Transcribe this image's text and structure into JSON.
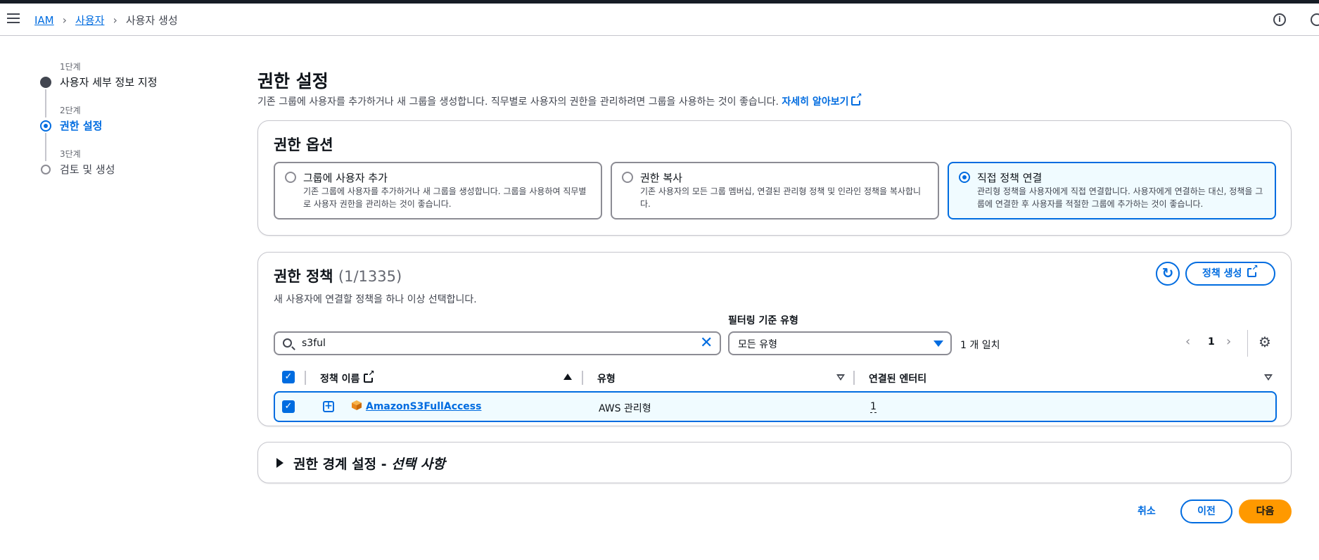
{
  "breadcrumb": {
    "items": [
      "IAM",
      "사용자"
    ],
    "current": "사용자 생성"
  },
  "icons": [
    "hamburger-icon",
    "info-icon",
    "search-icon",
    "clear-icon",
    "refresh-icon",
    "external-link-icon",
    "gear-icon",
    "aws-policy-icon",
    "expand-icon"
  ],
  "steps": [
    {
      "label": "1단계",
      "title": "사용자 세부 정보 지정",
      "state": "done"
    },
    {
      "label": "2단계",
      "title": "권한 설정",
      "state": "active"
    },
    {
      "label": "3단계",
      "title": "검토 및 생성",
      "state": "pending"
    }
  ],
  "page": {
    "title": "권한 설정",
    "description": "기존 그룹에 사용자를 추가하거나 새 그룹을 생성합니다. 직무별로 사용자의 권한을 관리하려면 그룹을 사용하는 것이 좋습니다.",
    "learn_more": "자세히 알아보기"
  },
  "permission_options": {
    "title": "권한 옵션",
    "options": [
      {
        "title": "그룹에 사용자 추가",
        "desc": "기존 그룹에 사용자를 추가하거나 새 그룹을 생성합니다. 그룹을 사용하여 직무별로 사용자 권한을 관리하는 것이 좋습니다.",
        "selected": false
      },
      {
        "title": "권한 복사",
        "desc": "기존 사용자의 모든 그룹 멤버십, 연결된 관리형 정책 및 인라인 정책을 복사합니다.",
        "selected": false
      },
      {
        "title": "직접 정책 연결",
        "desc": "관리형 정책을 사용자에게 직접 연결합니다. 사용자에게 연결하는 대신, 정책을 그룹에 연결한 후 사용자를 적절한 그룹에 추가하는 것이 좋습니다.",
        "selected": true
      }
    ]
  },
  "policies": {
    "title": "권한 정책",
    "count": "(1/1335)",
    "create_button": "정책 생성",
    "description": "새 사용자에 연결할 정책을 하나 이상 선택합니다.",
    "filter_label": "필터링 기준 유형",
    "search_value": "s3ful",
    "filter_value": "모든 유형",
    "match_text": "1 개 일치",
    "page_number": "1",
    "columns": [
      "정책 이름",
      "유형",
      "연결된 엔터티"
    ],
    "rows": [
      {
        "name": "AmazonS3FullAccess",
        "type": "AWS 관리형",
        "entities": "1",
        "checked": true
      }
    ]
  },
  "boundary": {
    "title": "권한 경계 설정 - ",
    "optional": "선택 사항"
  },
  "footer": {
    "cancel": "취소",
    "previous": "이전",
    "next": "다음"
  },
  "colors": {
    "accent": "#006ce0",
    "primary_button": "#ff9900",
    "selected_bg": "#f0fbff"
  }
}
